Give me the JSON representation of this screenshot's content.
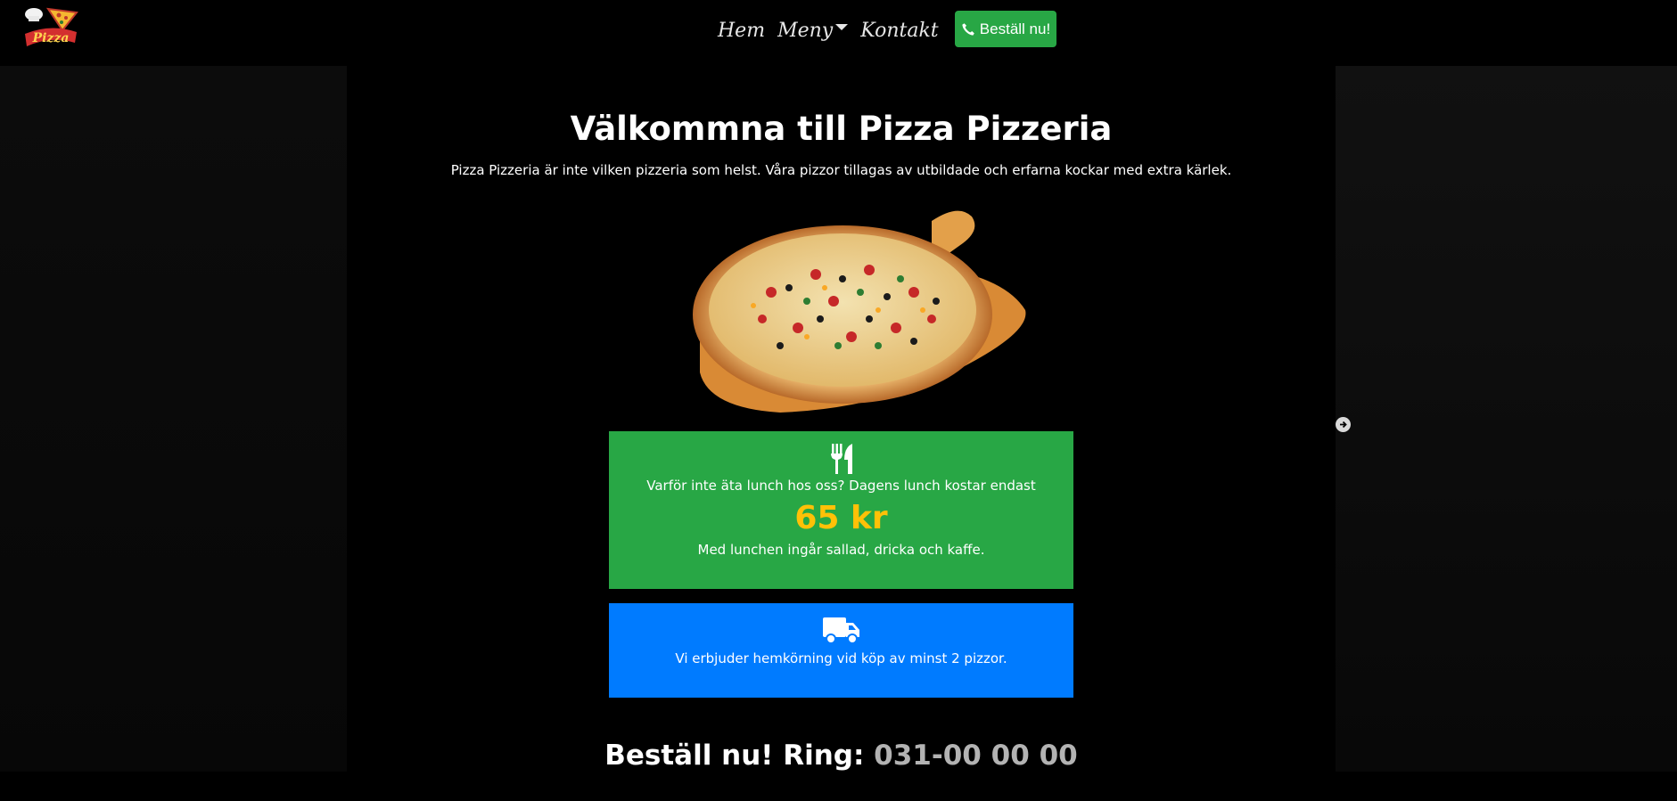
{
  "navbar": {
    "logo_text": "Pizza",
    "links": [
      {
        "label": "Hem"
      },
      {
        "label": "Meny"
      },
      {
        "label": "Kontakt"
      }
    ],
    "order_button": {
      "label": "Beställ nu!",
      "icon": "phone-icon"
    }
  },
  "hero": {
    "title": "Välkommna till Pizza Pizzeria",
    "subtitle": "Pizza Pizzeria är inte vilken pizzeria som helst. Våra pizzor tillagas av utbildade och erfarna kockar med extra kärlek."
  },
  "lunch": {
    "icon": "utensils-icon",
    "text": "Varför inte äta lunch hos oss? Dagens lunch kostar endast",
    "price": "65 kr",
    "includes": "Med lunchen ingår sallad, dricka och kaffe."
  },
  "delivery": {
    "icon": "truck-icon",
    "text": "Vi erbjuder hemkörning vid köp av minst 2 pizzor."
  },
  "call": {
    "label": "Beställ nu! Ring:",
    "number": "031-00 00 00"
  },
  "carousel": {
    "next_icon": "arrow-right-circle-icon"
  },
  "colors": {
    "green": "#28a745",
    "blue": "#007bff",
    "price_yellow": "#ffc107",
    "background": "#000000"
  }
}
